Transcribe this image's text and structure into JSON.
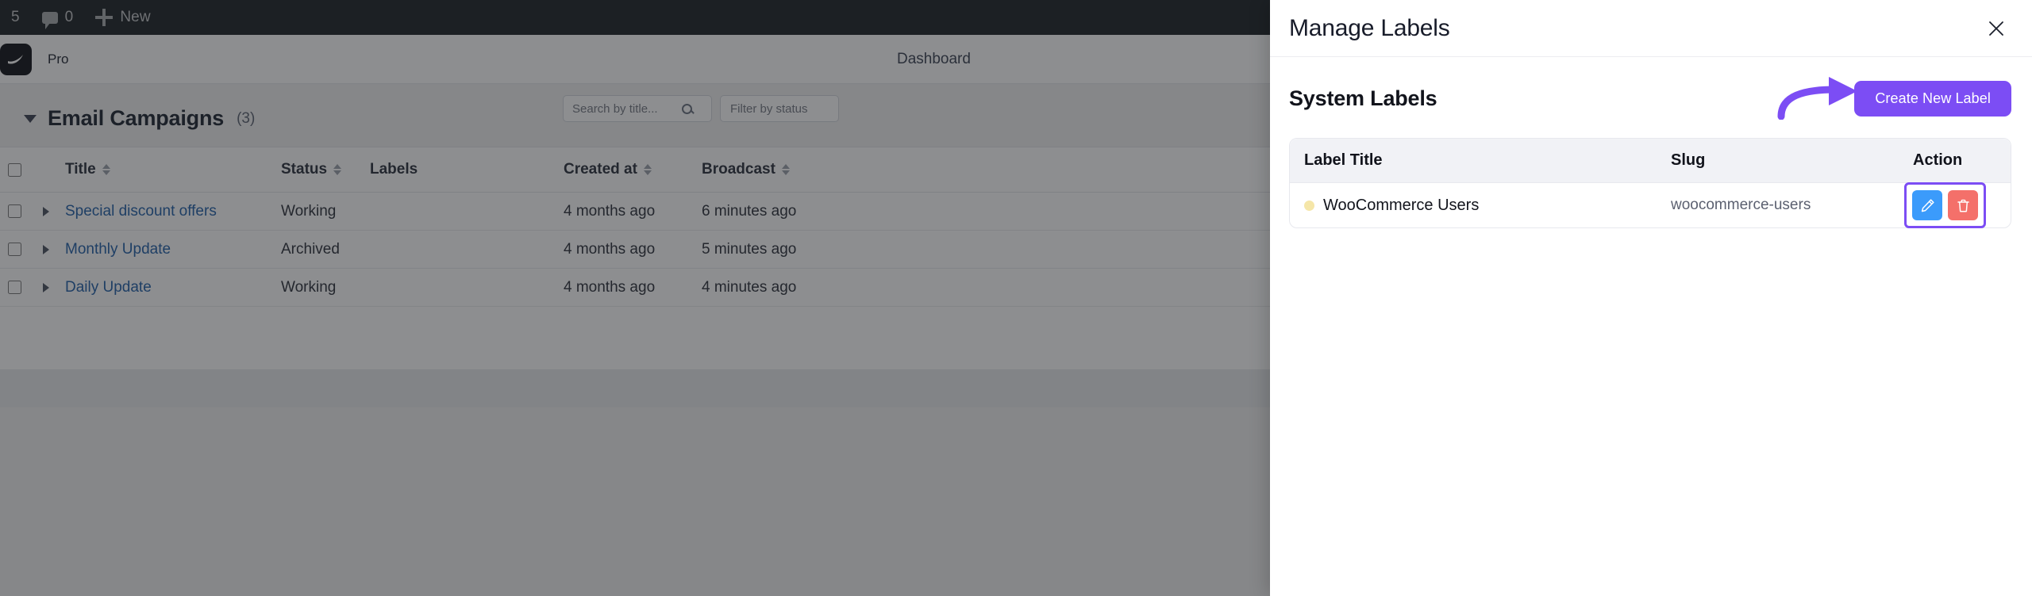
{
  "adminbar": {
    "updates_count": "5",
    "comments_count": "0",
    "new_label": "New",
    "comment_icon": "comment-bubble-icon",
    "plus_icon": "plus-icon"
  },
  "plugin_header": {
    "brand_name": "Pro",
    "nav": [
      "Dashboard"
    ]
  },
  "campaigns": {
    "section_title": "Email Campaigns",
    "count_label": "(3)",
    "collapse_icon": "chevron-down-icon",
    "search": {
      "placeholder": "Search by title...",
      "value": "",
      "icon": "search-icon"
    },
    "filter": {
      "placeholder": "Filter by status"
    },
    "columns": [
      {
        "key": "title",
        "label": "Title",
        "sortable": true
      },
      {
        "key": "status",
        "label": "Status",
        "sortable": true
      },
      {
        "key": "labels",
        "label": "Labels",
        "sortable": false
      },
      {
        "key": "created",
        "label": "Created at",
        "sortable": true
      },
      {
        "key": "broadcast",
        "label": "Broadcast",
        "sortable": true
      }
    ],
    "rows": [
      {
        "title": "Special discount offers",
        "status": "Working",
        "labels": "",
        "created": "4 months ago",
        "broadcast": "6 minutes ago",
        "expand_icon": "chevron-right-icon"
      },
      {
        "title": "Monthly Update",
        "status": "Archived",
        "labels": "",
        "created": "4 months ago",
        "broadcast": "5 minutes ago",
        "expand_icon": "chevron-right-icon"
      },
      {
        "title": "Daily Update",
        "status": "Working",
        "labels": "",
        "created": "4 months ago",
        "broadcast": "4 minutes ago",
        "expand_icon": "chevron-right-icon"
      }
    ]
  },
  "modal": {
    "title": "Manage Labels",
    "close_icon": "close-icon",
    "section_title": "System Labels",
    "create_button": "Create New Label",
    "annotation_arrow": "curved-arrow-annotation",
    "table": {
      "columns": [
        "Label Title",
        "Slug",
        "Action"
      ],
      "rows": [
        {
          "dot_color": "#F5E6A8",
          "title": "WooCommerce Users",
          "slug": "woocommerce-users",
          "actions": [
            {
              "name": "edit",
              "icon": "pencil-icon",
              "color": "#3B9BFB"
            },
            {
              "name": "delete",
              "icon": "trash-icon",
              "color": "#F4706A"
            }
          ]
        }
      ]
    }
  },
  "colors": {
    "accent_purple": "#7C4DF4",
    "edit_blue": "#3B9BFB",
    "delete_red": "#F4706A",
    "label_dot": "#F5E6A8",
    "link_blue": "#2260A8",
    "adminbar_bg": "#1D2327"
  }
}
